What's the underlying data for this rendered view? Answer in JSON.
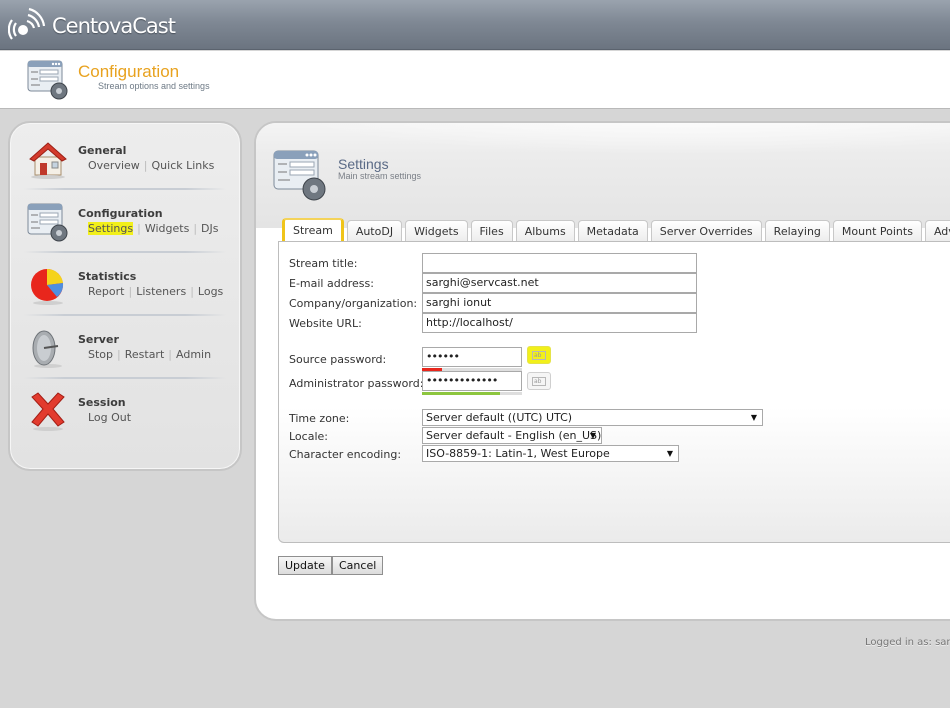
{
  "app": {
    "name": "CentovaCast"
  },
  "page_header": {
    "title": "Configuration",
    "subtitle": "Stream options and settings",
    "icon": "configuration-form-gear-icon"
  },
  "sidebar": {
    "groups": [
      {
        "title": "General",
        "icon": "house-icon",
        "links": [
          {
            "label": "Overview",
            "highlighted": false
          },
          {
            "label": "Quick Links",
            "highlighted": false
          }
        ]
      },
      {
        "title": "Configuration",
        "icon": "configuration-form-gear-icon",
        "links": [
          {
            "label": "Settings",
            "highlighted": true
          },
          {
            "label": "Widgets",
            "highlighted": false
          },
          {
            "label": "DJs",
            "highlighted": false
          }
        ]
      },
      {
        "title": "Statistics",
        "icon": "pie-chart-icon",
        "links": [
          {
            "label": "Report",
            "highlighted": false
          },
          {
            "label": "Listeners",
            "highlighted": false
          },
          {
            "label": "Logs",
            "highlighted": false
          }
        ]
      },
      {
        "title": "Server",
        "icon": "satellite-dish-icon",
        "links": [
          {
            "label": "Stop",
            "highlighted": false
          },
          {
            "label": "Restart",
            "highlighted": false
          },
          {
            "label": "Admin",
            "highlighted": false
          }
        ]
      },
      {
        "title": "Session",
        "icon": "red-x-icon",
        "links": [
          {
            "label": "Log Out",
            "highlighted": false
          }
        ]
      }
    ]
  },
  "main": {
    "section_title": "Settings",
    "section_subtitle": "Main stream settings",
    "tabs": [
      {
        "label": "Stream",
        "active": true
      },
      {
        "label": "AutoDJ",
        "active": false
      },
      {
        "label": "Widgets",
        "active": false
      },
      {
        "label": "Files",
        "active": false
      },
      {
        "label": "Albums",
        "active": false
      },
      {
        "label": "Metadata",
        "active": false
      },
      {
        "label": "Server Overrides",
        "active": false
      },
      {
        "label": "Relaying",
        "active": false
      },
      {
        "label": "Mount Points",
        "active": false
      },
      {
        "label": "Advanced",
        "active": false
      }
    ],
    "form": {
      "stream_title": {
        "label": "Stream title:",
        "value": ""
      },
      "email": {
        "label": "E-mail address:",
        "value": "sarghi@servcast.net"
      },
      "company": {
        "label": "Company/organization:",
        "value": "sarghi ionut"
      },
      "website": {
        "label": "Website URL:",
        "value": "http://localhost/"
      },
      "source_password": {
        "label": "Source password:",
        "masked_value": "••••••",
        "strength_percent": 20,
        "strength_color": "#e8261c",
        "generate_highlighted": true
      },
      "admin_password": {
        "label": "Administrator password:",
        "masked_value": "•••••••••••••",
        "strength_percent": 78,
        "strength_color": "#8dc63f",
        "generate_highlighted": false
      },
      "time_zone": {
        "label": "Time zone:",
        "selected": "Server default ((UTC) UTC)"
      },
      "locale": {
        "label": "Locale:",
        "selected": "Server default - English (en_US)"
      },
      "encoding": {
        "label": "Character encoding:",
        "selected": "ISO-8859-1: Latin-1, West Europe"
      }
    },
    "buttons": {
      "update": "Update",
      "cancel": "Cancel"
    }
  },
  "footer": {
    "logged_in_text": "Logged in as: sar"
  },
  "colors": {
    "accent_orange": "#e8a21f",
    "highlight_yellow": "#f2f01a",
    "active_tab_border": "#f0c419"
  }
}
